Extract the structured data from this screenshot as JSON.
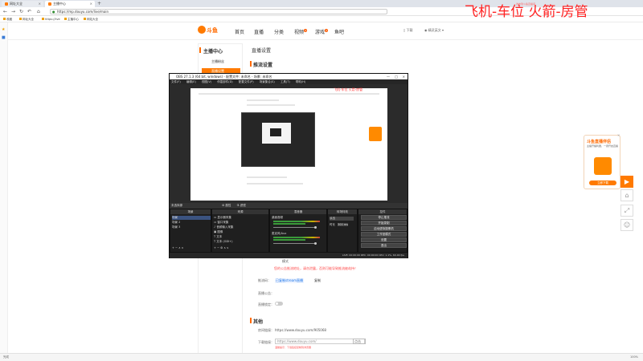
{
  "browser": {
    "tabs": [
      {
        "label": "网址大全",
        "active": false
      },
      {
        "label": "主播中心",
        "active": true
      }
    ],
    "url": "https://mp.douyu.com/live/main",
    "bookmarks": [
      "收藏",
      "网址大全",
      "https://live",
      "主播中心",
      "网站大全"
    ]
  },
  "watermark": {
    "text": "飞机-车位  火箭-房管",
    "small": "发布到斗鱼直播间"
  },
  "site": {
    "logo": "斗鱼",
    "nav": [
      "首页",
      "直播",
      "分类",
      "视频",
      "游戏",
      "鱼吧"
    ],
    "nav_badges": {
      "视频": "4",
      "游戏": "4"
    },
    "header_right": [
      "下载",
      "精灵英文 ▾"
    ]
  },
  "side_menu": {
    "title": "主播中心",
    "items": [
      {
        "label": "主播粉丝",
        "active": false
      },
      {
        "label": "直播设置",
        "active": true
      }
    ]
  },
  "main": {
    "title": "直播设置",
    "section1": "推流设置",
    "mode_label": "模式",
    "warning": "您的公告推流地址，请勿泄露，否则可能导致推流被劫持！",
    "code_label": "推流码：",
    "code_value": "已复制stream直播",
    "code_btn": "复制",
    "notice_label": "直播公告：",
    "lock_label": "直播锁定：",
    "section2": "其他",
    "room_label": "房间链接：",
    "room_value": "https://www.douyu.com/905068",
    "download_label": "下载链接：",
    "download_value": "https://www.douyu.com/",
    "download_select": "点击",
    "download_tip": "温馨提示：下载链接复制到浏览器"
  },
  "obs": {
    "title": "OBS 27.1.3 (64 bit, windows) - 配置文件: 未命名 - 场景: 未命名",
    "menu": [
      "文件(F)",
      "编辑(E)",
      "视图(V)",
      "停靠部件(D)",
      "配置文件(P)",
      "场景集合(S)",
      "工具(T)",
      "帮助(H)"
    ],
    "bottom_tabs": [
      "未选择源",
      "属性",
      "滤镜"
    ],
    "docks": {
      "scenes": {
        "title": "场景",
        "items": [
          "场景",
          "场景 2",
          "场景 3"
        ]
      },
      "sources": {
        "title": "来源",
        "items": [
          "显示器采集",
          "窗口采集",
          "音频输入采集",
          "图像",
          "文本",
          "文本 (GDI+)"
        ]
      },
      "mixer": {
        "title": "混音器",
        "tracks": [
          "桌面音频",
          "麦克风/Aux"
        ]
      },
      "transitions": {
        "title": "转场特效",
        "type": "淡出",
        "duration_label": "时长",
        "duration": "300 ms"
      },
      "controls": {
        "title": "控件",
        "buttons": [
          "停止推流",
          "开始录制",
          "启动虚拟摄像机",
          "工作室模式",
          "设置",
          "退出"
        ]
      }
    },
    "status": "LIVE: 00:00:00    REC: 00:00:00    CPU: 1.1%, 60.00 fps"
  },
  "preview_red_text": "飞机-车位  火箭-房管",
  "float_ad": {
    "title": "斗鱼直播伴侣",
    "desc": "主播开播利器，一键开启直播",
    "button": "立即下载"
  },
  "statusbar": {
    "left": "完成",
    "right": "100%"
  }
}
